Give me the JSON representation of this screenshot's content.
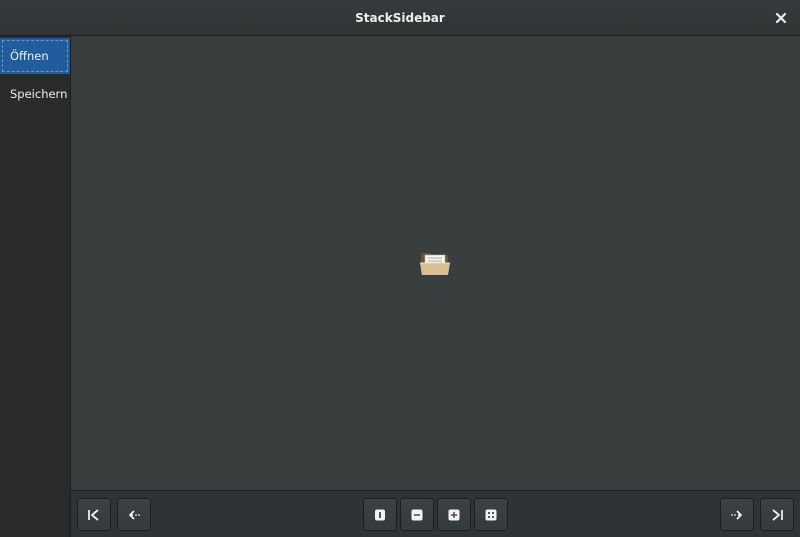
{
  "window": {
    "title": "StackSidebar"
  },
  "sidebar": {
    "items": [
      {
        "label": "Öffnen",
        "selected": true
      },
      {
        "label": "Speichern",
        "selected": false
      }
    ]
  },
  "content": {
    "icon": "folder-open-icon"
  },
  "actionbar": {
    "left_buttons": [
      "go-first-icon",
      "go-previous-icon"
    ],
    "center_buttons": [
      "page-icon",
      "minus-icon",
      "plus-icon",
      "fit-icon"
    ],
    "right_buttons": [
      "go-next-icon",
      "go-last-icon"
    ]
  },
  "colors": {
    "accent": "#215d9c",
    "background": "#393f3f",
    "sidebar": "#282a2b",
    "header": "#2f3435"
  }
}
